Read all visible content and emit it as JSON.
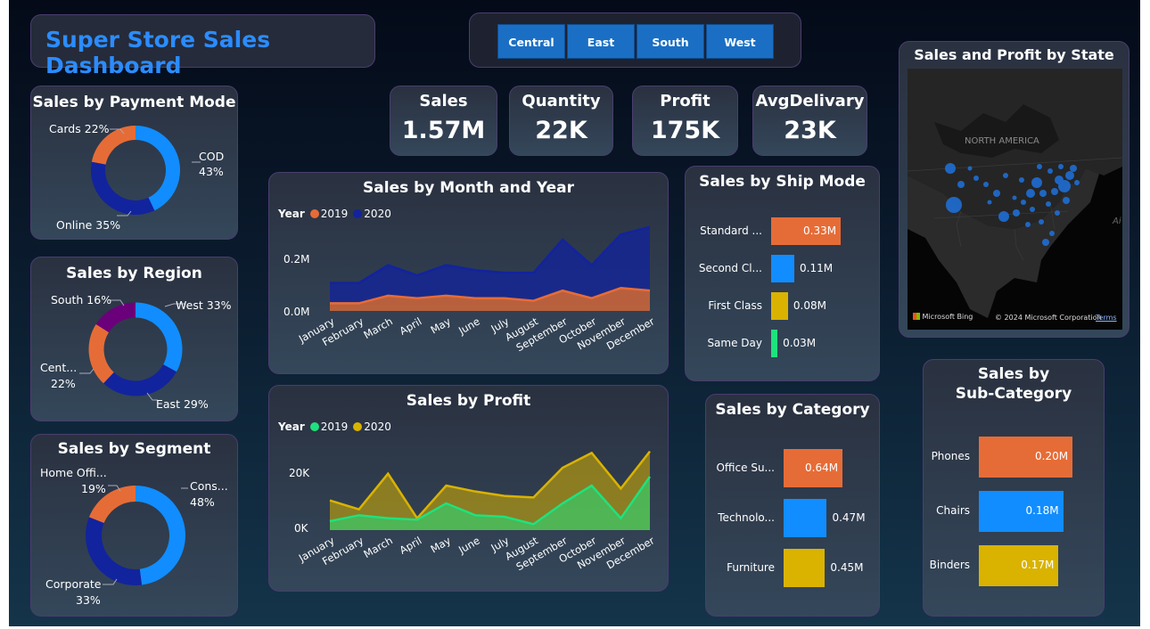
{
  "title": "Super Store Sales Dashboard",
  "slicer": [
    "Central",
    "East",
    "South",
    "West"
  ],
  "kpis": [
    {
      "label": "Sales",
      "value": "1.57M"
    },
    {
      "label": "Quantity",
      "value": "22K"
    },
    {
      "label": "Profit",
      "value": "175K"
    },
    {
      "label": "AvgDelivary",
      "value": "23K"
    }
  ],
  "payment": {
    "title": "Sales by Payment Mode",
    "labels": [
      {
        "text": "Cards 22%"
      },
      {
        "text": "COD"
      },
      {
        "text": "43%"
      },
      {
        "text": "Online 35%"
      }
    ]
  },
  "region": {
    "title": "Sales by Region",
    "labels": [
      {
        "text": "South 16%"
      },
      {
        "text": "West 33%"
      },
      {
        "text": "Cent..."
      },
      {
        "text": "22%"
      },
      {
        "text": "East 29%"
      }
    ]
  },
  "segment": {
    "title": "Sales by Segment",
    "labels": [
      {
        "text": "Home Offi..."
      },
      {
        "text": "19%"
      },
      {
        "text": "Cons..."
      },
      {
        "text": "48%"
      },
      {
        "text": "Corporate"
      },
      {
        "text": "33%"
      }
    ]
  },
  "monthYear": {
    "title": "Sales by Month and Year",
    "legend_title": "Year",
    "y_ticks": [
      "0.2M",
      "0.0M"
    ]
  },
  "profitChart": {
    "title": "Sales by Profit",
    "legend_title": "Year",
    "y_ticks": [
      "20K",
      "0K"
    ]
  },
  "ship": {
    "title": "Sales by Ship Mode"
  },
  "category": {
    "title": "Sales by Category"
  },
  "subcat": {
    "title_line1": "Sales by",
    "title_line2": "Sub-Category"
  },
  "map": {
    "title": "Sales and Profit by State",
    "region_label": "NORTH AMERICA",
    "bing": "Microsoft Bing",
    "copyright": "© 2024 Microsoft Corporation",
    "terms": "Terms",
    "edge": "Ai"
  },
  "colors": {
    "blue": "#118dff",
    "navy": "#12239e",
    "orange": "#e66c37",
    "purple": "#6b007b",
    "gold": "#d9b300",
    "green": "#1aab40",
    "mint": "#1ee27d"
  },
  "chart_data": [
    {
      "type": "pie",
      "title": "Sales by Payment Mode",
      "categories": [
        "COD",
        "Online",
        "Cards"
      ],
      "values": [
        43,
        35,
        22
      ]
    },
    {
      "type": "pie",
      "title": "Sales by Region",
      "categories": [
        "West",
        "East",
        "Central",
        "South"
      ],
      "values": [
        33,
        29,
        22,
        16
      ]
    },
    {
      "type": "pie",
      "title": "Sales by Segment",
      "categories": [
        "Consumer",
        "Corporate",
        "Home Office"
      ],
      "values": [
        48,
        33,
        19
      ]
    },
    {
      "type": "area",
      "title": "Sales by Month and Year",
      "categories": [
        "January",
        "February",
        "March",
        "April",
        "May",
        "June",
        "July",
        "August",
        "September",
        "October",
        "November",
        "December"
      ],
      "series": [
        {
          "name": "2019",
          "values": [
            0.03,
            0.03,
            0.06,
            0.05,
            0.06,
            0.05,
            0.05,
            0.04,
            0.08,
            0.05,
            0.09,
            0.08
          ]
        },
        {
          "name": "2020",
          "values": [
            0.08,
            0.08,
            0.12,
            0.09,
            0.12,
            0.11,
            0.1,
            0.11,
            0.2,
            0.13,
            0.21,
            0.25
          ]
        }
      ],
      "stacked": true,
      "ylim": [
        0,
        0.28
      ]
    },
    {
      "type": "area",
      "title": "Sales by Profit",
      "categories": [
        "January",
        "February",
        "March",
        "April",
        "May",
        "June",
        "July",
        "August",
        "September",
        "October",
        "November",
        "December"
      ],
      "series": [
        {
          "name": "2019",
          "values": [
            3000,
            5000,
            4000,
            3500,
            9000,
            5000,
            4500,
            2000,
            9000,
            15000,
            4000,
            18000
          ]
        },
        {
          "name": "2020",
          "values": [
            10000,
            7000,
            19000,
            4000,
            15000,
            13000,
            11500,
            11000,
            21000,
            26000,
            14000,
            26500
          ]
        }
      ],
      "ylim": [
        0,
        30000
      ]
    },
    {
      "type": "bar",
      "title": "Sales by Ship Mode",
      "categories": [
        "Standard ...",
        "Second Cl...",
        "First Class",
        "Same Day"
      ],
      "values": [
        0.33,
        0.11,
        0.08,
        0.03
      ],
      "value_labels": [
        "0.33M",
        "0.11M",
        "0.08M",
        "0.03M"
      ]
    },
    {
      "type": "bar",
      "title": "Sales by Category",
      "categories": [
        "Office Su...",
        "Technolo...",
        "Furniture"
      ],
      "values": [
        0.64,
        0.47,
        0.45
      ],
      "value_labels": [
        "0.64M",
        "0.47M",
        "0.45M"
      ]
    },
    {
      "type": "bar",
      "title": "Sales by Sub-Category",
      "categories": [
        "Phones",
        "Chairs",
        "Binders"
      ],
      "values": [
        0.2,
        0.18,
        0.17
      ],
      "value_labels": [
        "0.20M",
        "0.18M",
        "0.17M"
      ]
    }
  ]
}
